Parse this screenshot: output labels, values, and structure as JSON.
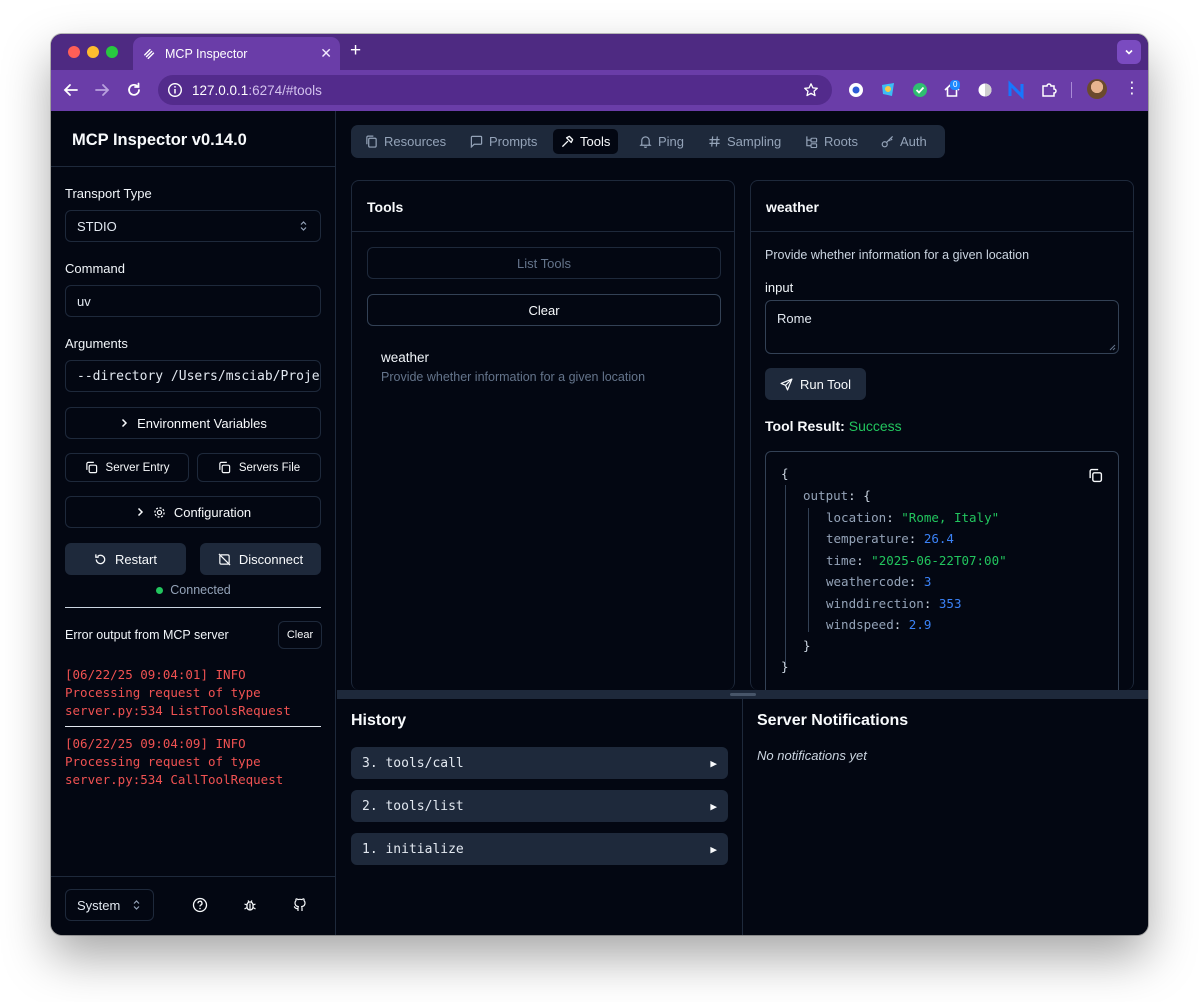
{
  "browser": {
    "tab_title": "MCP Inspector",
    "url_host": "127.0.0.1",
    "url_rest": ":6274/#tools",
    "extension_badge": "0"
  },
  "sidebar": {
    "title": "MCP Inspector v0.14.0",
    "transport_label": "Transport Type",
    "transport_value": "STDIO",
    "command_label": "Command",
    "command_value": "uv",
    "arguments_label": "Arguments",
    "arguments_value": "--directory /Users/msciab/Proje",
    "env_vars_label": "Environment Variables",
    "server_entry_label": "Server Entry",
    "servers_file_label": "Servers File",
    "configuration_label": "Configuration",
    "restart_label": "Restart",
    "disconnect_label": "Disconnect",
    "status": "Connected",
    "error_title": "Error output from MCP server",
    "error_clear_label": "Clear",
    "logs": [
      "[06/22/25 09:04:01] INFO\nProcessing request of type\nserver.py:534 ListToolsRequest",
      "[06/22/25 09:04:09] INFO\nProcessing request of type\nserver.py:534 CallToolRequest"
    ],
    "theme_value": "System"
  },
  "main": {
    "tabs": [
      "Resources",
      "Prompts",
      "Tools",
      "Ping",
      "Sampling",
      "Roots",
      "Auth"
    ],
    "active_tab": "Tools",
    "tools_panel": {
      "title": "Tools",
      "list_tools_label": "List Tools",
      "clear_label": "Clear",
      "items": [
        {
          "name": "weather",
          "description": "Provide whether information for a given location"
        }
      ]
    },
    "tool_panel": {
      "title": "weather",
      "description": "Provide whether information for a given location",
      "input_label": "input",
      "input_value": "Rome",
      "run_label": "Run Tool",
      "result_label": "Tool Result:",
      "result_status": "Success",
      "result": {
        "output_key": "output",
        "fields": [
          {
            "key": "location",
            "value": "\"Rome, Italy\"",
            "type": "string"
          },
          {
            "key": "temperature",
            "value": "26.4",
            "type": "number"
          },
          {
            "key": "time",
            "value": "\"2025-06-22T07:00\"",
            "type": "string"
          },
          {
            "key": "weathercode",
            "value": "3",
            "type": "number"
          },
          {
            "key": "winddirection",
            "value": "353",
            "type": "number"
          },
          {
            "key": "windspeed",
            "value": "2.9",
            "type": "number"
          }
        ]
      }
    },
    "history": {
      "title": "History",
      "items": [
        "3. tools/call",
        "2. tools/list",
        "1. initialize"
      ]
    },
    "notifications": {
      "title": "Server Notifications",
      "empty": "No notifications yet"
    }
  },
  "colors": {
    "chrome_dark": "#4e2a82",
    "chrome": "#6a3da8",
    "app_bg": "#030712",
    "success": "#22c55e",
    "error_log": "#f05252",
    "json_number": "#3b82f6"
  }
}
